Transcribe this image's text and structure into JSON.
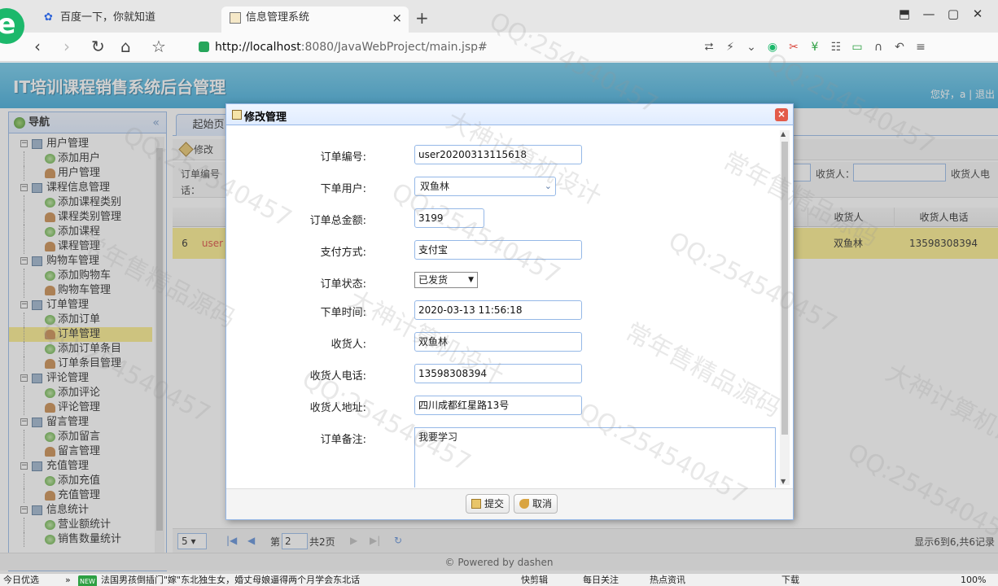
{
  "browser": {
    "tabs": [
      {
        "title": "百度一下，你就知道"
      },
      {
        "title": "信息管理系统"
      }
    ],
    "close_tab": "×",
    "new_tab": "+",
    "url_host": "http://localhost",
    "url_rest": ":8080/JavaWebProject/main.jsp#",
    "win_controls": [
      "⬒",
      "—",
      "▢",
      "✕"
    ]
  },
  "app": {
    "title": "IT培训课程销售系统后台管理",
    "greeting": "您好，a | 退出",
    "nav_title": "导航",
    "collapse": "«",
    "menu": [
      {
        "label": "用户管理",
        "children": [
          "添加用户",
          "用户管理"
        ]
      },
      {
        "label": "课程信息管理",
        "children": [
          "添加课程类别",
          "课程类别管理",
          "添加课程",
          "课程管理"
        ]
      },
      {
        "label": "购物车管理",
        "children": [
          "添加购物车",
          "购物车管理"
        ]
      },
      {
        "label": "订单管理",
        "children": [
          "添加订单",
          "订单管理",
          "添加订单条目",
          "订单条目管理"
        ]
      },
      {
        "label": "评论管理",
        "children": [
          "添加评论",
          "评论管理"
        ]
      },
      {
        "label": "留言管理",
        "children": [
          "添加留言",
          "留言管理"
        ]
      },
      {
        "label": "充值管理",
        "children": [
          "添加充值",
          "充值管理"
        ]
      },
      {
        "label": "信息统计",
        "children": [
          "营业额统计",
          "销售数量统计"
        ]
      }
    ],
    "selected_menu": "订单管理",
    "home_tab": "起始页",
    "toolbar_edit": "修改",
    "search": {
      "order_no_label": "订单编号",
      "line2_label": "话：",
      "receiver_label": "收货人：",
      "receiver_phone_label": "收货人电"
    },
    "grid": {
      "headers": [
        "收货人",
        "收货人电话"
      ],
      "row": {
        "index": "6",
        "order_prefix": "user",
        "receiver": "双鱼林",
        "phone": "13598308394"
      }
    },
    "pager": {
      "page_size": "5",
      "page_label": "第",
      "page_value": "2",
      "total_pages": "共2页",
      "info": "显示6到6,共6记录"
    },
    "footer": "© Powered by dashen"
  },
  "dialog": {
    "title": "修改管理",
    "close": "×",
    "fields": {
      "order_no": {
        "label": "订单编号:",
        "value": "user20200313115618"
      },
      "user": {
        "label": "下单用户:",
        "value": "双鱼林"
      },
      "total": {
        "label": "订单总金额:",
        "value": "3199"
      },
      "pay": {
        "label": "支付方式:",
        "value": "支付宝"
      },
      "status": {
        "label": "订单状态:",
        "value": "已发货"
      },
      "time": {
        "label": "下单时间:",
        "value": "2020-03-13 11:56:18"
      },
      "receiver": {
        "label": "收货人:",
        "value": "双鱼林"
      },
      "phone": {
        "label": "收货人电话:",
        "value": "13598308394"
      },
      "address": {
        "label": "收货人地址:",
        "value": "四川成都红星路13号"
      },
      "memo": {
        "label": "订单备注:",
        "value": "我要学习"
      }
    },
    "submit": "提交",
    "cancel": "取消"
  },
  "watermarks": {
    "qq": "QQ:254540457",
    "pc": "大神计算机设计",
    "src": "常年售精品源码"
  },
  "taskbar": {
    "left": "今日优选",
    "badge": "NEW",
    "news": "法国男孩倒插门\"嫁\"东北独生女，婚丈母娘逼得两个月学会东北话",
    "kuaijian": "快剪辑",
    "daily": "每日关注",
    "hot": "热点资讯",
    "download": "下载",
    "zoom": "100%"
  }
}
